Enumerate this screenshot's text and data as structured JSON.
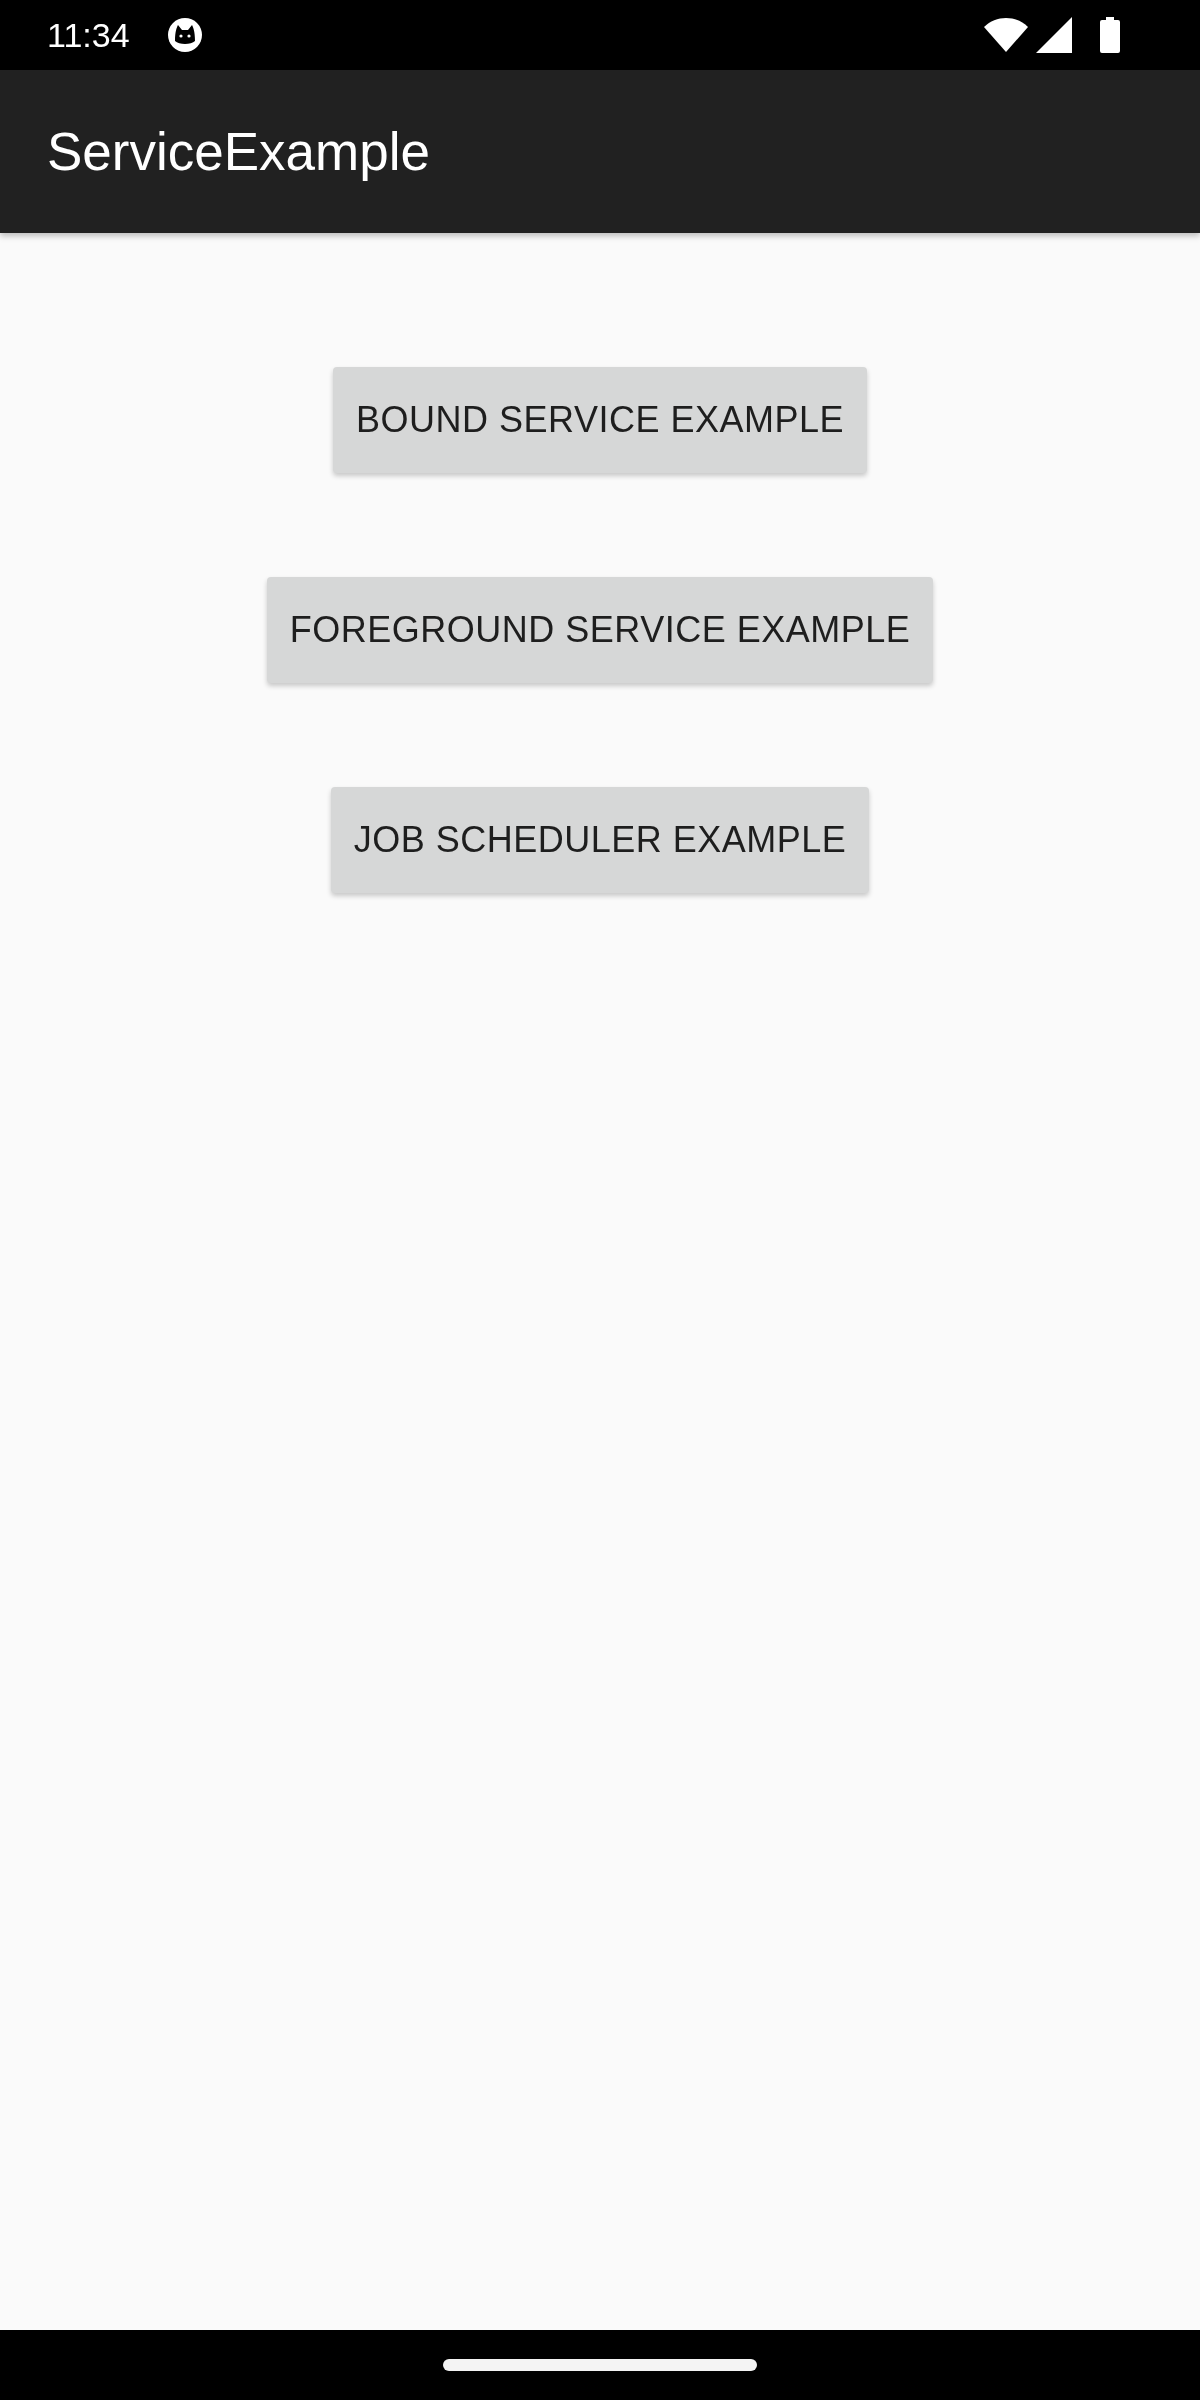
{
  "status_bar": {
    "time": "11:34"
  },
  "app_bar": {
    "title": "ServiceExample"
  },
  "buttons": [
    {
      "label": "BOUND SERVICE EXAMPLE"
    },
    {
      "label": "FOREGROUND SERVICE EXAMPLE"
    },
    {
      "label": "JOB SCHEDULER EXAMPLE"
    }
  ]
}
